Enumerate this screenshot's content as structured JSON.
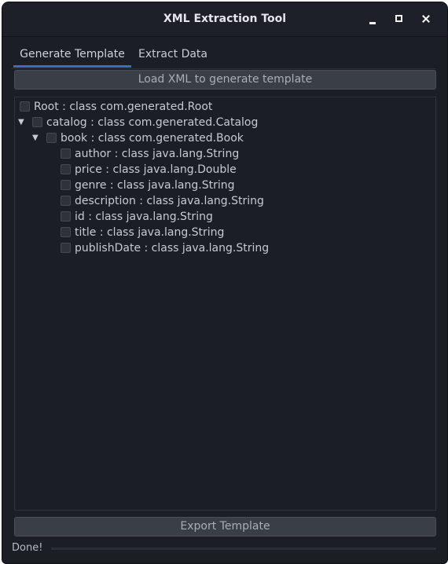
{
  "window": {
    "title": "XML Extraction Tool"
  },
  "tabs": [
    {
      "label": "Generate Template",
      "active": true
    },
    {
      "label": "Extract Data",
      "active": false
    }
  ],
  "toolbar": {
    "load_label": "Load XML to generate template",
    "export_label": "Export Template"
  },
  "tree": {
    "root": "Root : class com.generated.Root",
    "catalog": "catalog : class com.generated.Catalog",
    "book": "book : class com.generated.Book",
    "fields": [
      "author : class java.lang.String",
      "price : class java.lang.Double",
      "genre : class java.lang.String",
      "description : class java.lang.String",
      "id : class java.lang.String",
      "title : class java.lang.String",
      "publishDate : class java.lang.String"
    ]
  },
  "status": {
    "text": "Done!"
  },
  "icons": {
    "minimize": "minimize-icon",
    "maximize": "maximize-icon",
    "close": "close-icon",
    "expand": "expand-arrow-icon"
  },
  "colors": {
    "accent": "#3d6cc0",
    "background": "#1b1e25",
    "button": "#3a3e47"
  }
}
